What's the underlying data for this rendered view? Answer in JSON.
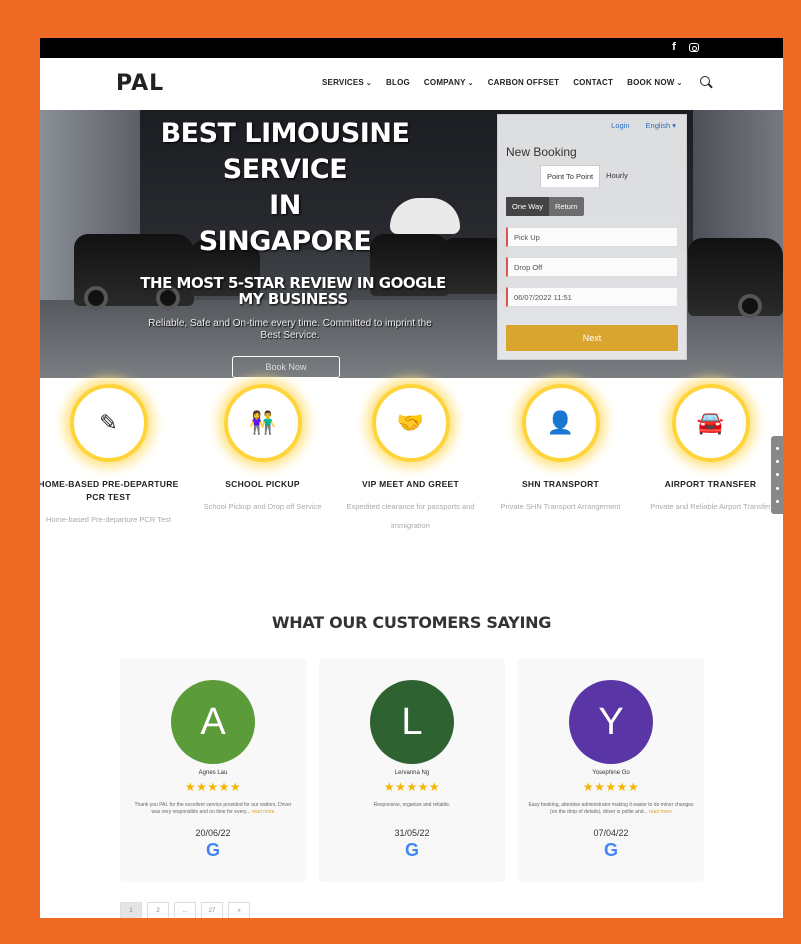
{
  "nav": {
    "logo": "PAL",
    "items": [
      {
        "label": "SERVICES",
        "has_dropdown": true
      },
      {
        "label": "BLOG",
        "has_dropdown": false
      },
      {
        "label": "COMPANY",
        "has_dropdown": true
      },
      {
        "label": "CARBON OFFSET",
        "has_dropdown": false
      },
      {
        "label": "CONTACT",
        "has_dropdown": false
      },
      {
        "label": "BOOK NOW",
        "has_dropdown": true
      }
    ]
  },
  "hero": {
    "title_lines": [
      "BEST LIMOUSINE",
      "SERVICE",
      "IN",
      "SINGAPORE"
    ],
    "subtitle": "THE MOST 5-STAR REVIEW IN GOOGLE MY BUSINESS",
    "description": "Reliable, Safe and On-time every time. Committed to imprint the Best Service.",
    "button": "Book Now"
  },
  "booking": {
    "login": "Login",
    "language": "English",
    "title": "New Booking",
    "tabs": [
      "Point To Point",
      "Hourly"
    ],
    "trip_types": [
      "One Way",
      "Return"
    ],
    "pickup_placeholder": "Pick Up",
    "dropoff_placeholder": "Drop Off",
    "datetime_value": "06/07/2022 11:51",
    "next_button": "Next"
  },
  "services": [
    {
      "name": "HOME-BASED PRE-DEPARTURE PCR TEST",
      "desc": "Home-based Pre-departure PCR Test"
    },
    {
      "name": "SCHOOL PICKUP",
      "desc": "School Pickup and Drop off Service"
    },
    {
      "name": "VIP MEET AND GREET",
      "desc": "Expedited clearance for passports and immigration"
    },
    {
      "name": "SHN TRANSPORT",
      "desc": "Private SHN Transport Arrangement"
    },
    {
      "name": "AIRPORT TRANSFER",
      "desc": "Private and Reliable Airport Transfer"
    }
  ],
  "reviews_title": "WHAT OUR CUSTOMERS SAYING",
  "reviews": [
    {
      "initial": "A",
      "name": "Agnes Lau",
      "color": "#5b9b3a",
      "text": "Thank you PAL for the excellent service provided for our visitors. Driver was very responsible and on time for every...",
      "more": "read more",
      "date": "20/06/22"
    },
    {
      "initial": "L",
      "name": "Lervanna Ng",
      "color": "#2e6331",
      "text": "Responsive, organize and reliable.",
      "more": "",
      "date": "31/05/22"
    },
    {
      "initial": "Y",
      "name": "Yosephine Go",
      "color": "#5a35a6",
      "text": "Easy booking, attentive administrator making it easier to do minor changes (on the drop of details), driver is polite and...",
      "more": "read more",
      "date": "07/04/22"
    }
  ],
  "pager": [
    "1",
    "2",
    "...",
    "27",
    "»"
  ],
  "colors": {
    "frame": "#ee6a25",
    "accent": "#d9a52e",
    "star": "#f4b400",
    "ring": "#ffd43a"
  }
}
